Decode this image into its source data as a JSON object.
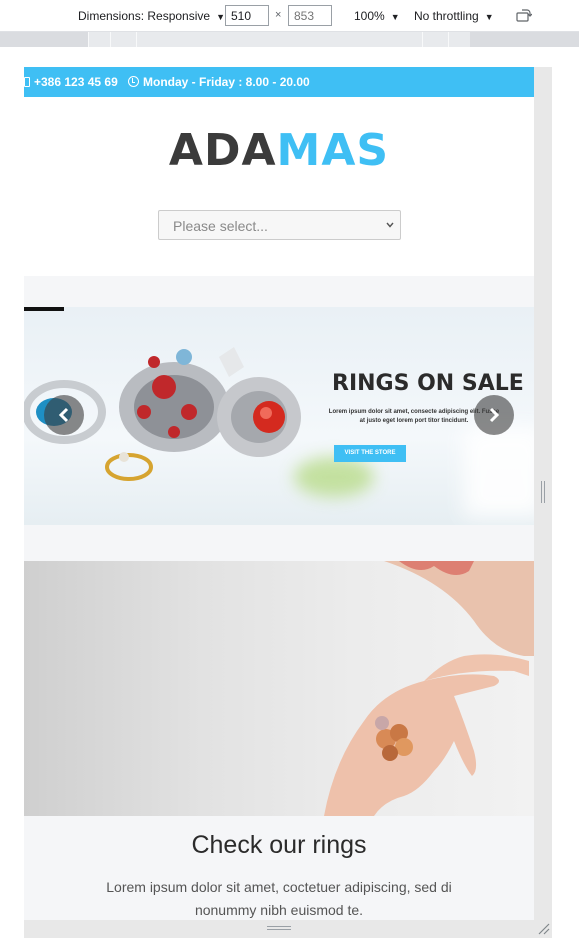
{
  "devtools": {
    "dimensions_label": "Dimensions: Responsive",
    "width_value": "510",
    "times_symbol": "×",
    "height_placeholder": "853",
    "zoom": "100%",
    "throttling": "No throttling",
    "rotate_icon": "rotate-device-icon"
  },
  "site": {
    "phone": "+386 123 45 69",
    "hours": "Monday - Friday : 8.00 - 20.00",
    "logo_part1": "ADA",
    "logo_part2": "MAS",
    "select_placeholder": "Please select...",
    "slide": {
      "title": "RINGS ON SALE",
      "text": "Lorem ipsum dolor sit amet, consecte adipiscing elit. Fusce at justo eget lorem port titor tincidunt.",
      "cta": "VISIT THE STORE"
    },
    "section": {
      "heading": "Check our rings",
      "paragraph": "Lorem ipsum dolor sit amet, coctetuer adipiscing, sed di nonummy nibh euismod te."
    }
  },
  "colors": {
    "accent": "#3fbff4",
    "logo_dark": "#3b3b3b",
    "band_bg": "#f5f6f8"
  }
}
